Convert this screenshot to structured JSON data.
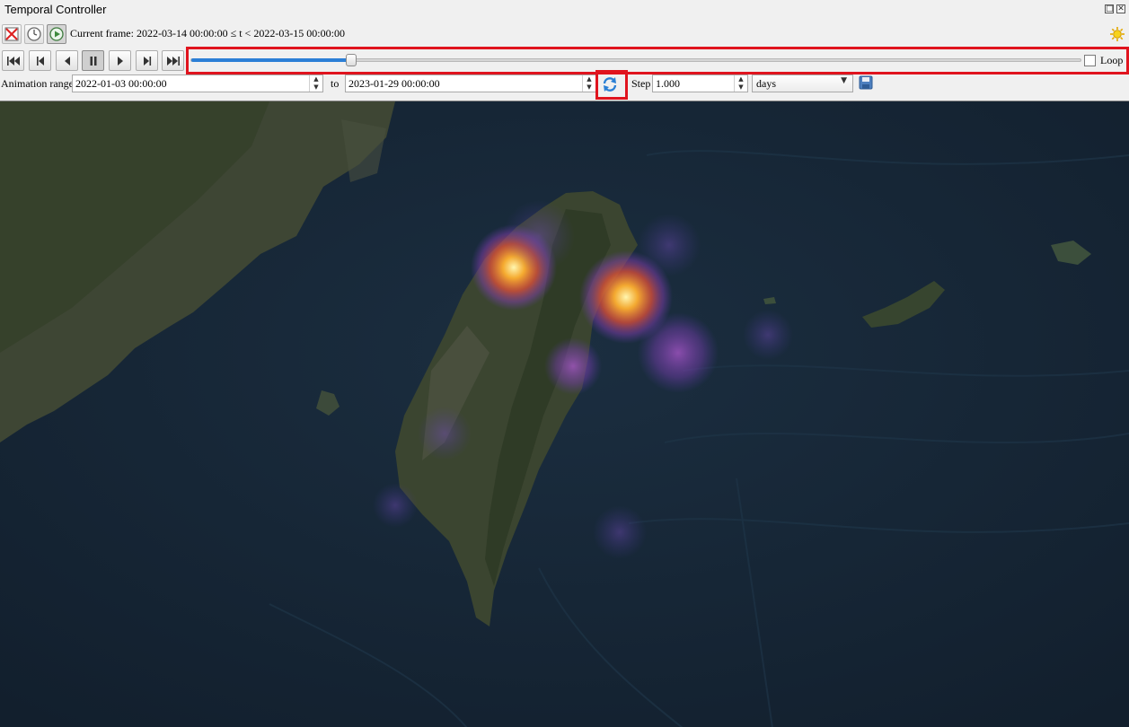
{
  "window": {
    "title": "Temporal Controller"
  },
  "toolbar": {
    "current_frame_label": "Current frame: 2022-03-14 00:00:00 ≤ t < 2022-03-15 00:00:00",
    "icons": [
      "disable-temporal-icon",
      "fixed-range-icon",
      "animated-navigation-icon",
      "settings-sun-icon"
    ]
  },
  "playback": {
    "buttons": [
      "skip-to-start",
      "previous-frame",
      "play-backward",
      "pause",
      "play-forward",
      "next-frame",
      "skip-to-end"
    ],
    "slider_position_fraction": 0.18,
    "loop_label": "Loop",
    "loop_checked": false
  },
  "range": {
    "animation_range_label": "Animation range",
    "start": "2022-01-03 00:00:00",
    "to_label": "to",
    "end": "2023-01-29 00:00:00",
    "step_label": "Step",
    "step_value": "1.000",
    "step_unit": "days"
  },
  "colors": {
    "accent": "#2b7fd6",
    "highlight": "#e0141e"
  }
}
